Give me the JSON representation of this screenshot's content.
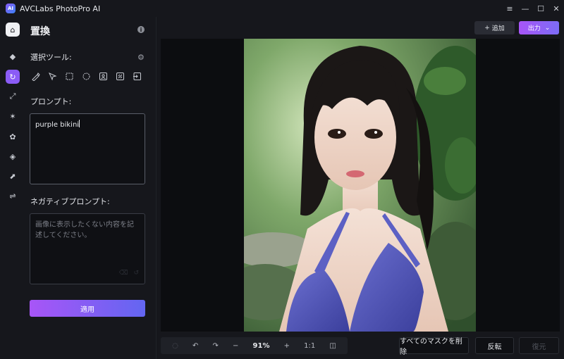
{
  "window": {
    "title": "AVCLabs PhotoPro AI",
    "logo_text": "AI",
    "controls": {
      "menu": "≡",
      "minimize": "—",
      "maximize": "☐",
      "close": "✕"
    }
  },
  "rail": {
    "items": [
      {
        "name": "home-icon",
        "glyph": "⌂"
      },
      {
        "name": "eraser-icon",
        "glyph": "◆"
      },
      {
        "name": "replace-icon",
        "glyph": "↻"
      },
      {
        "name": "upscale-icon",
        "glyph": "⤢"
      },
      {
        "name": "portrait-icon",
        "glyph": "✶"
      },
      {
        "name": "face-icon",
        "glyph": "✿"
      },
      {
        "name": "fill-icon",
        "glyph": "◈"
      },
      {
        "name": "expand-icon",
        "glyph": "⬈"
      },
      {
        "name": "adjust-icon",
        "glyph": "⇌"
      }
    ]
  },
  "panel": {
    "title": "置換",
    "selection_tools_label": "選択ツール:",
    "prompt_label": "プロンプト:",
    "prompt_value": "purple bikini",
    "negative_label": "ネガティブプロンプト:",
    "negative_placeholder": "画像に表示したくない内容を記述してください。",
    "apply_label": "適用"
  },
  "topbar": {
    "add_label": "追加",
    "add_glyph": "+",
    "export_label": "出力",
    "export_glyph": "⌄"
  },
  "bottombar": {
    "zoom_value": "91%",
    "fit_label": "1:1",
    "minus": "−",
    "plus": "+",
    "undo": "↶",
    "redo": "↷",
    "clear_masks_label": "すべてのマスクを削除",
    "invert_label": "反転",
    "restore_label": "復元"
  },
  "colors": {
    "accent": "#8b5cf6",
    "background": "#16171c",
    "canvas": "#0c0d10"
  }
}
